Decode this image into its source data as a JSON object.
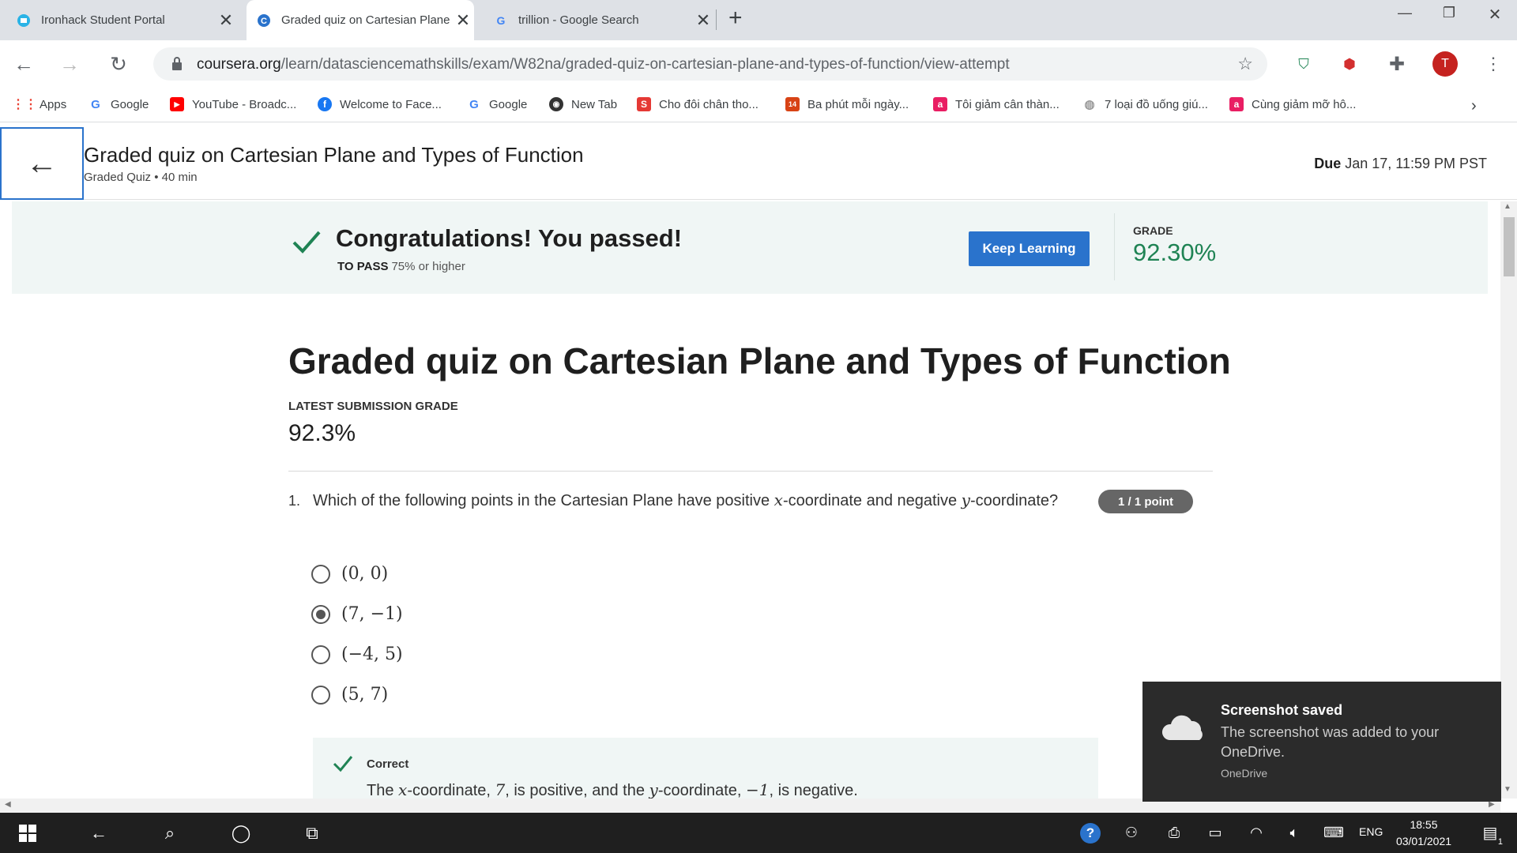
{
  "browser": {
    "tabs": [
      {
        "title": "Ironhack Student Portal",
        "icon": "ironhack-icon"
      },
      {
        "title": "Graded quiz on Cartesian Plane",
        "icon": "coursera-icon"
      },
      {
        "title": "trillion - Google Search",
        "icon": "google-icon"
      }
    ],
    "new_tab": "+",
    "url_domain": "coursera.org",
    "url_path": "/learn/datasciencemathskills/exam/W82na/graded-quiz-on-cartesian-plane-and-types-of-function/view-attempt",
    "profile_initial": "T",
    "bookmarks": [
      {
        "label": "Apps",
        "icon": "apps-grid-icon"
      },
      {
        "label": "Google",
        "icon": "google-icon"
      },
      {
        "label": "YouTube - Broadc...",
        "icon": "youtube-icon"
      },
      {
        "label": "Welcome to Face...",
        "icon": "facebook-icon"
      },
      {
        "label": "Google",
        "icon": "google-icon"
      },
      {
        "label": "New Tab",
        "icon": "github-icon"
      },
      {
        "label": "Cho đôi chân tho...",
        "icon": "s-icon"
      },
      {
        "label": "Ba phút mỗi ngày...",
        "icon": "kenh14-icon"
      },
      {
        "label": "Tôi giảm cân thàn...",
        "icon": "a-icon"
      },
      {
        "label": "7 loại đồ uống giú...",
        "icon": "globe-icon"
      },
      {
        "label": "Cùng giảm mỡ hô...",
        "icon": "a-icon"
      }
    ]
  },
  "header": {
    "title": "Graded quiz on Cartesian Plane and Types of Function",
    "subtitle": "Graded Quiz • 40 min",
    "due_label": "Due",
    "due_value": "Jan 17, 11:59 PM PST"
  },
  "banner": {
    "message": "Congratulations! You passed!",
    "to_pass_label": "TO PASS",
    "to_pass_value": "75% or higher",
    "button": "Keep Learning",
    "grade_label": "GRADE",
    "grade_value": "92.30%"
  },
  "quiz": {
    "title": "Graded quiz on Cartesian Plane and Types of Function",
    "latest_label": "LATEST SUBMISSION GRADE",
    "latest_value": "92.3%",
    "question_number": "1.",
    "question_prefix": "Which of the following points in the Cartesian Plane have positive ",
    "question_x": "x",
    "question_mid": "-coordinate and negative ",
    "question_y": "y",
    "question_suffix": "-coordinate?",
    "points_badge": "1 / 1 point",
    "options": [
      {
        "label": "(0, 0)",
        "selected": false
      },
      {
        "label": "(7, −1)",
        "selected": true
      },
      {
        "label": "(−4, 5)",
        "selected": false
      },
      {
        "label": "(5, 7)",
        "selected": false
      }
    ],
    "feedback_label": "Correct",
    "feedback_p1": "The ",
    "feedback_x": "x",
    "feedback_p2": "-coordinate, ",
    "feedback_v1": "7",
    "feedback_p3": ", is positive, and the ",
    "feedback_y": "y",
    "feedback_p4": "-coordinate, ",
    "feedback_v2": "−1",
    "feedback_p5": ", is negative."
  },
  "toast": {
    "title": "Screenshot saved",
    "text": "The screenshot was added to your OneDrive.",
    "source": "OneDrive"
  },
  "taskbar": {
    "language": "ENG",
    "time": "18:55",
    "date": "03/01/2021",
    "notification_count": "1"
  },
  "colors": {
    "accent": "#2a73cc",
    "success": "#1f8354",
    "banner_bg": "#f0f6f5"
  }
}
